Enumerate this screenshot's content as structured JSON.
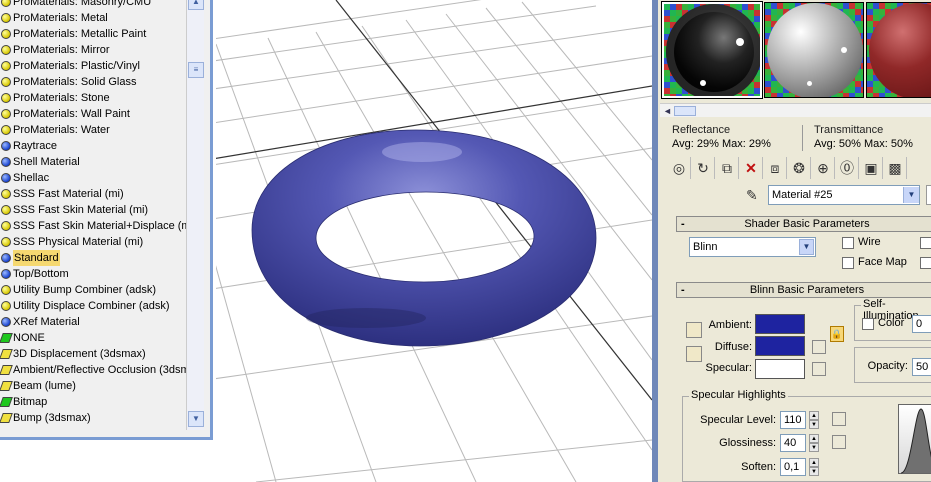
{
  "browser": {
    "items": [
      {
        "label": "ProMaterials: Masonry/CMU",
        "icon": "yellow-sphere-icon",
        "selected": false
      },
      {
        "label": "ProMaterials: Metal",
        "icon": "yellow-sphere-icon",
        "selected": false
      },
      {
        "label": "ProMaterials: Metallic Paint",
        "icon": "yellow-sphere-icon",
        "selected": false
      },
      {
        "label": "ProMaterials: Mirror",
        "icon": "yellow-sphere-icon",
        "selected": false
      },
      {
        "label": "ProMaterials: Plastic/Vinyl",
        "icon": "yellow-sphere-icon",
        "selected": false
      },
      {
        "label": "ProMaterials: Solid Glass",
        "icon": "yellow-sphere-icon",
        "selected": false
      },
      {
        "label": "ProMaterials: Stone",
        "icon": "yellow-sphere-icon",
        "selected": false
      },
      {
        "label": "ProMaterials: Wall Paint",
        "icon": "yellow-sphere-icon",
        "selected": false
      },
      {
        "label": "ProMaterials: Water",
        "icon": "yellow-sphere-icon",
        "selected": false
      },
      {
        "label": "Raytrace",
        "icon": "blue-sphere-icon",
        "selected": false
      },
      {
        "label": "Shell Material",
        "icon": "blue-sphere-icon",
        "selected": false
      },
      {
        "label": "Shellac",
        "icon": "blue-sphere-icon",
        "selected": false
      },
      {
        "label": "SSS Fast Material (mi)",
        "icon": "yellow-sphere-icon",
        "selected": false
      },
      {
        "label": "SSS Fast Skin Material (mi)",
        "icon": "yellow-sphere-icon",
        "selected": false
      },
      {
        "label": "SSS Fast Skin Material+Displace (mi)",
        "icon": "yellow-sphere-icon",
        "selected": false
      },
      {
        "label": "SSS Physical Material (mi)",
        "icon": "yellow-sphere-icon",
        "selected": false
      },
      {
        "label": "Standard",
        "icon": "blue-sphere-icon",
        "selected": true
      },
      {
        "label": "Top/Bottom",
        "icon": "blue-sphere-icon",
        "selected": false
      },
      {
        "label": "Utility Bump Combiner (adsk)",
        "icon": "yellow-sphere-icon",
        "selected": false
      },
      {
        "label": "Utility Displace Combiner (adsk)",
        "icon": "yellow-sphere-icon",
        "selected": false
      },
      {
        "label": "XRef Material",
        "icon": "blue-sphere-icon",
        "selected": false
      },
      {
        "label": "NONE",
        "icon": "green-map-icon",
        "selected": false
      },
      {
        "label": "3D Displacement (3dsmax)",
        "icon": "yellow-map-icon",
        "selected": false
      },
      {
        "label": "Ambient/Reflective Occlusion (3dsm",
        "icon": "yellow-map-icon",
        "selected": false
      },
      {
        "label": "Beam (lume)",
        "icon": "yellow-map-icon",
        "selected": false
      },
      {
        "label": "Bitmap",
        "icon": "green-map-icon",
        "selected": false
      },
      {
        "label": "Bump (3dsmax)",
        "icon": "yellow-map-icon",
        "selected": false
      }
    ]
  },
  "editor": {
    "reflectance": {
      "title": "Reflectance",
      "values": "Avg: 29% Max: 29%"
    },
    "transmittance": {
      "title": "Transmittance",
      "values": "Avg: 50% Max: 50%"
    },
    "material_name": "Material #25",
    "shader_rollout": {
      "title": "Shader Basic Parameters",
      "shader": "Blinn",
      "wire_label": "Wire",
      "face_map_label": "Face Map"
    },
    "blinn_rollout": {
      "title": "Blinn Basic Parameters",
      "self_illum_title": "Self-Illumination",
      "color_label": "Color",
      "color_value": "0",
      "ambient_label": "Ambient:",
      "diffuse_label": "Diffuse:",
      "specular_label": "Specular:",
      "opacity_label": "Opacity:",
      "opacity_value": "50",
      "ambient_color": "#1e23a0",
      "diffuse_color": "#1e23a0",
      "specular_color": "#ffffff"
    },
    "specular_highlights": {
      "title": "Specular Highlights",
      "level_label": "Specular Level:",
      "level_value": "110",
      "gloss_label": "Glossiness:",
      "gloss_value": "40",
      "soften_label": "Soften:",
      "soften_value": "0,1"
    }
  },
  "viewport": {
    "torus_color": "#4a4fa8"
  }
}
